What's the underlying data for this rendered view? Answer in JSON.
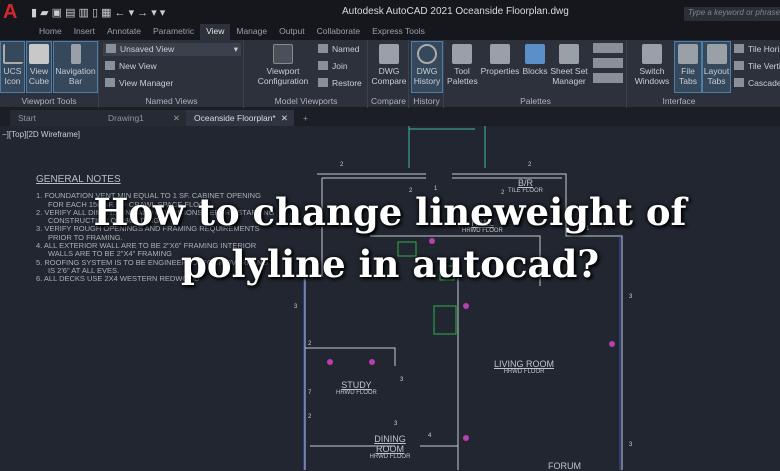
{
  "titlebar": {
    "logo": "A",
    "quick_access": [
      "new-icon",
      "open-icon",
      "save-icon",
      "save-as-icon",
      "plot-icon",
      "share-icon",
      "print-icon",
      "undo-icon",
      "redo-icon",
      "customize-icon"
    ],
    "title": "Autodesk AutoCAD 2021   Oceanside Floorplan.dwg",
    "search_placeholder": "Type a keyword or phrase"
  },
  "ribbon_tabs": [
    "Home",
    "Insert",
    "Annotate",
    "Parametric",
    "View",
    "Manage",
    "Output",
    "Collaborate",
    "Express Tools"
  ],
  "active_tab": "View",
  "ribbon": {
    "viewport_tools": {
      "label": "Viewport Tools",
      "ucs": "UCS Icon",
      "viewcube": "View Cube",
      "navbar": "Navigation Bar"
    },
    "named_views": {
      "label": "Named Views",
      "dropdown": "Unsaved View",
      "new_view": "New View",
      "view_manager": "View Manager"
    },
    "model_viewports": {
      "label": "Model Viewports",
      "config": "Viewport Configuration",
      "named": "Named",
      "join": "Join",
      "restore": "Restore"
    },
    "compare": {
      "label": "Compare",
      "dwg_compare": "DWG Compare"
    },
    "history": {
      "label": "History",
      "dwg_history": "DWG History"
    },
    "palettes": {
      "label": "Palettes",
      "tool_palettes": "Tool Palettes",
      "properties": "Properties",
      "blocks": "Blocks",
      "sheet_set": "Sheet Set Manager"
    },
    "interface": {
      "label": "Interface",
      "switch_windows": "Switch Windows",
      "file_tabs": "File Tabs",
      "layout_tabs": "Layout Tabs",
      "tile_h": "Tile Horizontally",
      "tile_v": "Tile Vertically",
      "cascade": "Cascade"
    }
  },
  "doc_tabs": [
    {
      "label": "Start"
    },
    {
      "label": "Drawing1"
    },
    {
      "label": "Oceanside Floorplan*"
    }
  ],
  "viewport_label": "−][Top][2D Wireframe]",
  "notes": {
    "title": "GENERAL NOTES",
    "items": [
      "1.  FOUNDATION VENT MIN EQUAL TO 1 SF. CABINET OPENING FOR EACH 150 SF. OF CRAWL SPACE FLOOR",
      "2.  VERIFY ALL DIMENSIONS AND CONDITIONS BEFORE STARTING CONSTRUCTION OR BUILDING.",
      "3.  VERIFY ROUGH OPENINGS AND FRAMING REQUIREMENTS PRIOR TO FRAMING.",
      "4.  ALL EXTERIOR WALL ARE TO BE 2\"X6\" FRAMING INTERIOR WALLS ARE TO BE 2\"X4\" FRAMING",
      "5.  ROOFING SYSTEM IS TO BE ENGINEERED. ROOF OVERHANG IS 2'6\" AT ALL EVES.",
      "6.  ALL DECKS USE 2X4 WESTERN REDWOOD"
    ]
  },
  "rooms": {
    "br": "B/R",
    "br_floor": "TILE FLOOR",
    "hall": "HALL",
    "hall_floor": "HRWD FLOOR",
    "living": "LIVING ROOM",
    "living_floor": "HRWD FLOOR",
    "study": "STUDY",
    "study_floor": "HRWD FLOOR",
    "dining": "DINING ROOM",
    "dining_floor": "HRWD FLOOR",
    "forum": "FORUM"
  },
  "dims": [
    "2",
    "2",
    "2",
    "1",
    "2",
    "1",
    "3",
    "3",
    "2",
    "7",
    "2",
    "3",
    "4",
    "3",
    "3"
  ],
  "overlay": {
    "line1": "How to change lineweight of",
    "line2": "polyline in autocad?"
  }
}
